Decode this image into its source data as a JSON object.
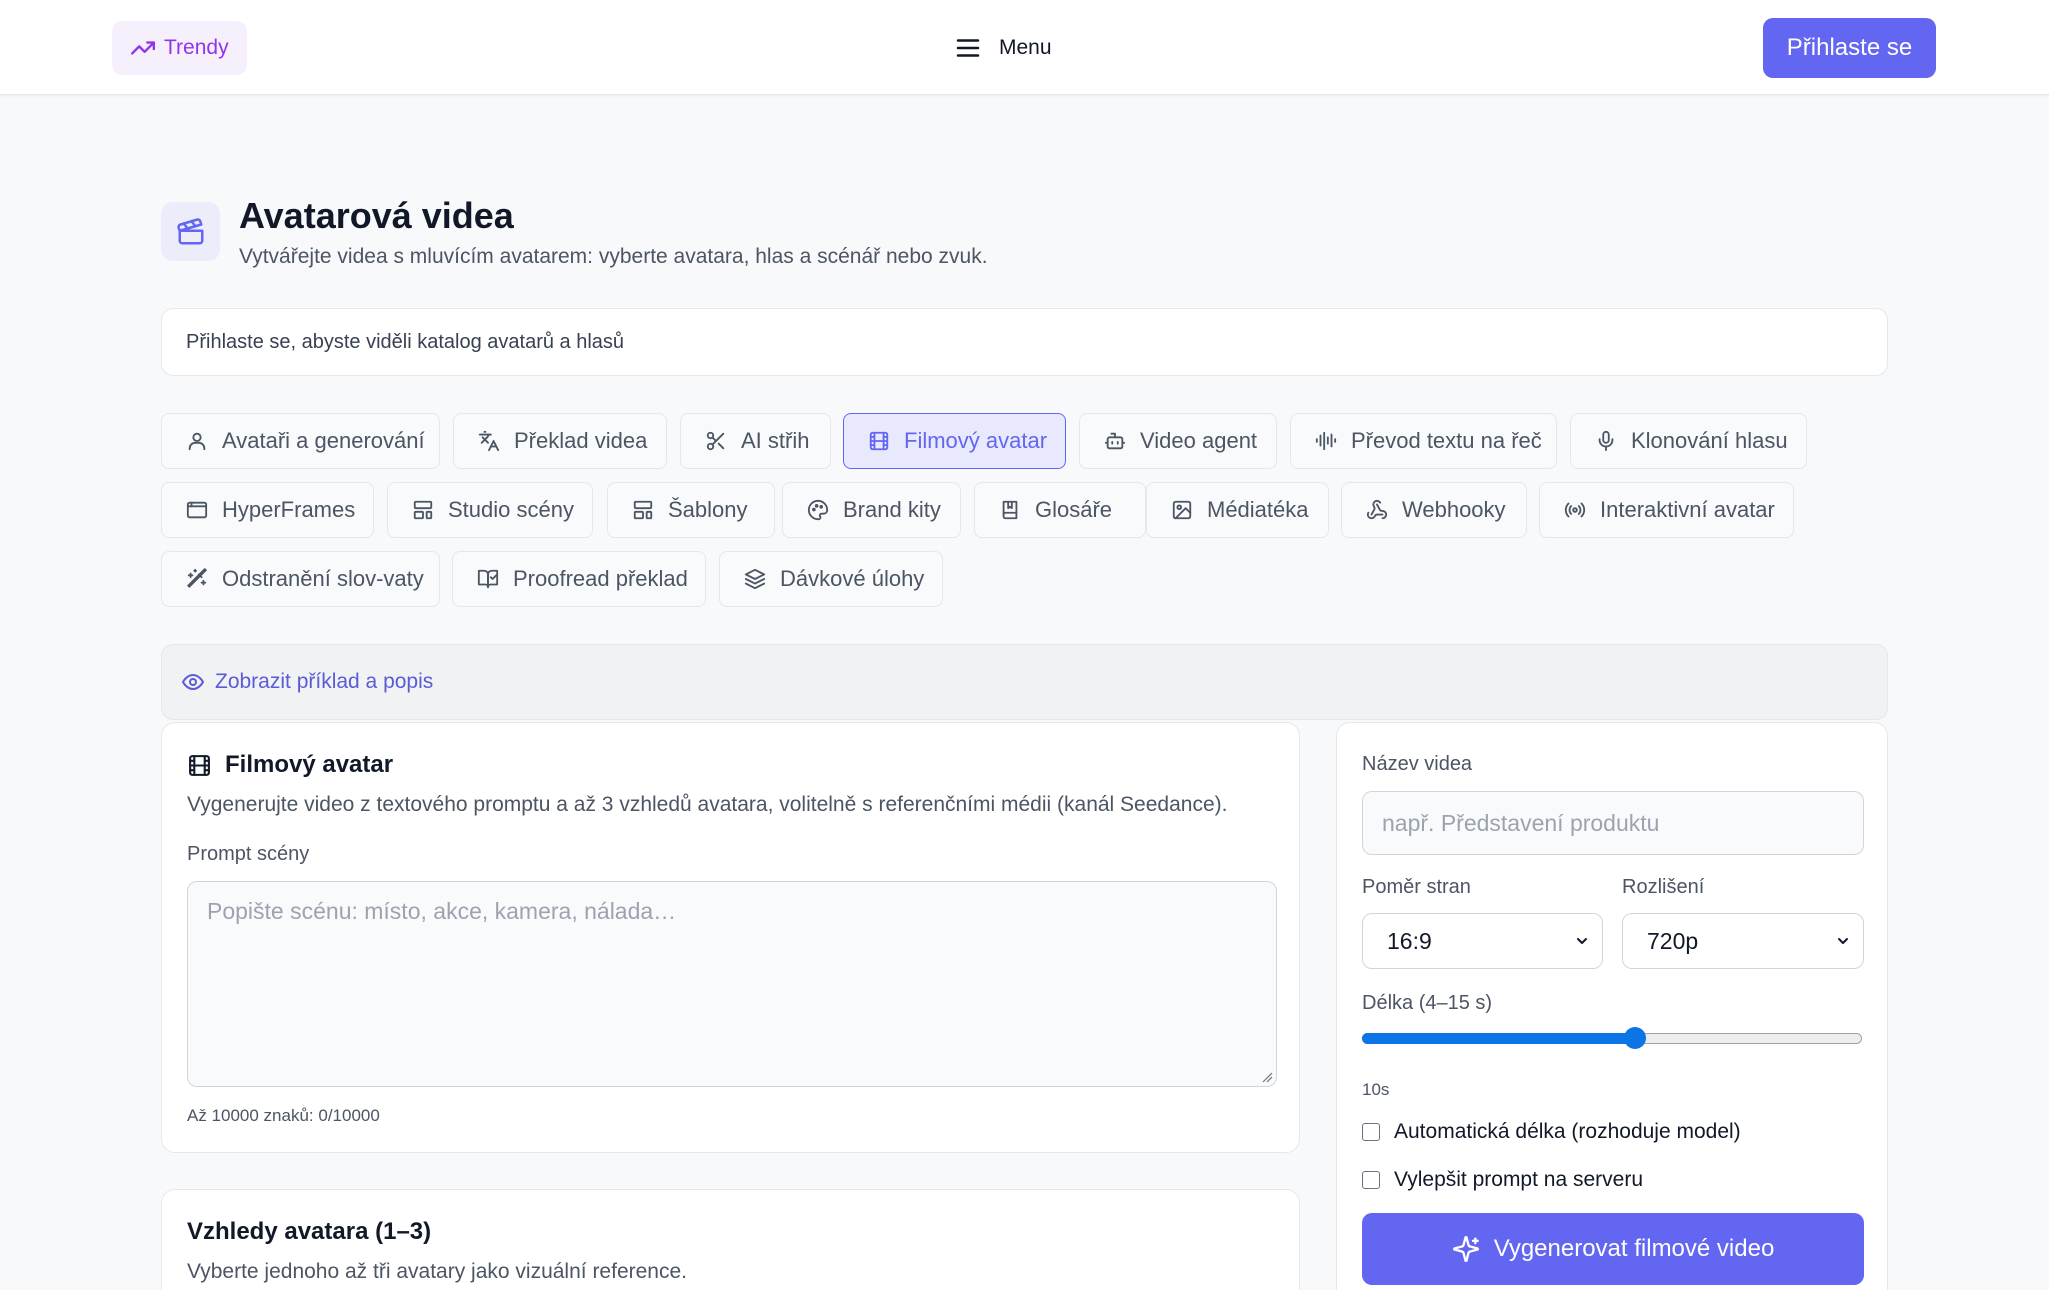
{
  "header": {
    "trend_label": "Trendy",
    "menu_label": "Menu",
    "login_label": "Přihlaste se"
  },
  "page": {
    "title": "Avatarová videa",
    "subtitle": "Vytvářejte videa s mluvícím avatarem: vyberte avatara, hlas a scénář nebo zvuk.",
    "notice": "Přihlaste se, abyste viděli katalog avatarů a hlasů"
  },
  "tabs": [
    {
      "label": "Avataři a generování",
      "icon": "user-icon"
    },
    {
      "label": "Překlad videa",
      "icon": "translate-icon"
    },
    {
      "label": "AI střih",
      "icon": "scissors-icon"
    },
    {
      "label": "Filmový avatar",
      "icon": "film-icon",
      "active": true
    },
    {
      "label": "Video agent",
      "icon": "bot-icon"
    },
    {
      "label": "Převod textu na řeč",
      "icon": "audio-waveform-icon"
    },
    {
      "label": "Klonování hlasu",
      "icon": "microphone-icon"
    },
    {
      "label": "HyperFrames",
      "icon": "app-window-icon"
    },
    {
      "label": "Studio scény",
      "icon": "layout-icon"
    },
    {
      "label": "Šablony",
      "icon": "layout-icon"
    },
    {
      "label": "Brand kity",
      "icon": "palette-icon"
    },
    {
      "label": "Glosáře",
      "icon": "book-icon"
    },
    {
      "label": "Médiatéka",
      "icon": "image-icon"
    },
    {
      "label": "Webhooky",
      "icon": "webhook-icon"
    },
    {
      "label": "Interaktivní avatar",
      "icon": "radio-icon"
    },
    {
      "label": "Odstranění slov-vaty",
      "icon": "magic-wand-icon"
    },
    {
      "label": "Proofread překlad",
      "icon": "book-check-icon"
    },
    {
      "label": "Dávkové úlohy",
      "icon": "layers-icon"
    }
  ],
  "example_toggle": "Zobrazit příklad a popis",
  "film_card": {
    "title": "Filmový avatar",
    "description": "Vygenerujte video z textového promptu a až 3 vzhledů avatara, volitelně s referenčními médii (kanál Seedance).",
    "prompt_label": "Prompt scény",
    "prompt_placeholder": "Popište scénu: místo, akce, kamera, nálada…",
    "counter": "Až 10000 znaků: 0/10000"
  },
  "looks_card": {
    "title": "Vzhledy avatara (1–3)",
    "description": "Vyberte jednoho až tři avatary jako vizuální reference."
  },
  "settings": {
    "name_label": "Název videa",
    "name_placeholder": "např. Představení produktu",
    "aspect_label": "Poměr stran",
    "aspect_value": "16:9",
    "resolution_label": "Rozlišení",
    "resolution_value": "720p",
    "duration_label": "Délka (4–15 s)",
    "duration_min": 4,
    "duration_max": 15,
    "duration_value": 10,
    "duration_display": "10s",
    "auto_length_label": "Automatická délka (rozhoduje model)",
    "auto_length_checked": false,
    "enhance_label": "Vylepšit prompt na serveru",
    "enhance_checked": false,
    "generate_label": "Vygenerovat filmové video"
  },
  "colors": {
    "accent": "#6366f1",
    "trend": "#9333ea",
    "slider": "#0b74e6"
  }
}
